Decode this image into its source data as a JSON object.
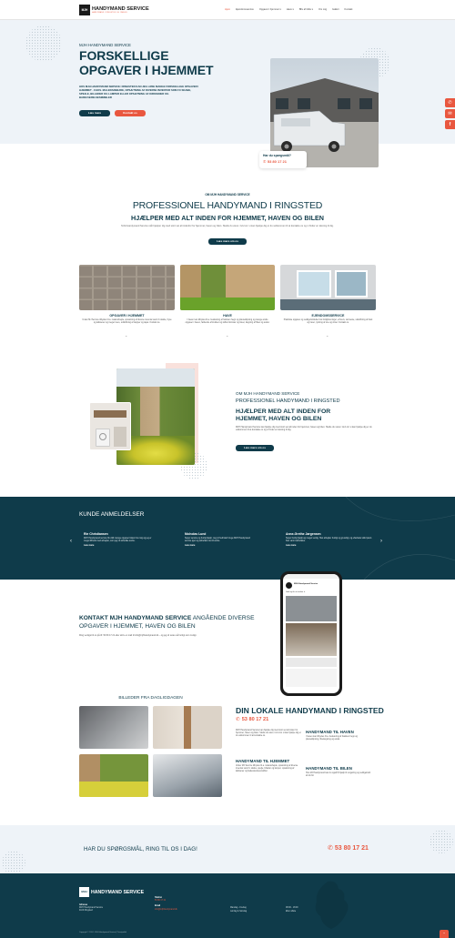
{
  "header": {
    "logo_mark": "MJH",
    "logo_text": "HANDYMAND SERVICE",
    "logo_sub": "HANDYMAND I RINGSTED OG OMEGN",
    "nav": [
      "Hjem",
      "Ejendomsservice",
      "Opgaver i hjemmet ▾",
      "Have ▾",
      "Bliv af folks ▾",
      "Om mig",
      "Galleri",
      "Kontakt"
    ]
  },
  "hero": {
    "kicker": "MJH HANDYMAND SERVICE",
    "title_line1": "FORSKELLIGE",
    "title_line2": "OPGAVER I HJEMMET",
    "text": "HOS MJH HANDYMAND SERVICE I RINGSTED KAN JEG LØSE MANGE FORSKELLIGE OPGAVER I HJEMMET - F.EKS. MALERARBEJDE, OPSÆTNING AF DIVERSE INVENTAR SOM FX SKABE, SPEJLE, BILLEDER OG LAMPER ELLER OPSÆTNING AF KØKKENER OG BADEVÆRELSESMØBLER",
    "btn_primary": "Læs mere",
    "btn_secondary": "Kontakt os",
    "question": "Har du spørgsmål?",
    "phone": "53 80 17 21"
  },
  "side_buttons": [
    "phone-icon",
    "mail-icon",
    "facebook-icon"
  ],
  "intro": {
    "kicker": "OM MJH HANDYMAND SERVICE",
    "title": "PROFESSIONEL HANDYMAND I RINGSTED",
    "subtitle": "HJÆLPER MED ALT INDEN FOR HJEMMET, HAVEN OG BILEN",
    "text": "MJH Handymand Service står hjælper dig med stort set alt indenfor for hjemmet, haven og bilen. Skulle du være i tvivl om vi kan hjælpe dig er du velkommen til at kontakte os og vi finder en løsning til dig.",
    "button": "Læs mere om os"
  },
  "services": [
    {
      "title": "OPGAVER I HJEMMET",
      "text": "Under MJ Service tilbydes bl.a. malerarbejde, opsætning af diverse inventar samt fx skabe, fryse og køkkener og meget mere, udskiftning af tæpper og tapet. Kontakt os.",
      "arrow": "⌄"
    },
    {
      "title": "HAVE",
      "text": "I haven kan tilbydes bl.a. beskæring af hækken hegn og plæneklipning og mange andre opgaver i haven, faldende af krukker og skifte blomster og træer, lægning af fliser og andet.",
      "arrow": "⌄"
    },
    {
      "title": "EJENDOMSSERVICE",
      "text": "Praktiske opgaver og vedligeholdelse hos boligforeninger, erhverv, varmeste, udskiftning af hæk og træer, rydning af sne og vinter. Kontakt os.",
      "arrow": "⌄"
    }
  ],
  "about": {
    "kicker": "OM MJH HANDYMAND SERVICE",
    "title": "PROFESSIONEL HANDYMAND I RINGSTED",
    "subtitle": "HJÆLPER MED ALT INDEN FOR HJEMMET, HAVEN OG BILEN",
    "text": "MJH Handymand Service kan hjælpe dig med stort set alt inden for hjemmet, haven og bilen. Skulle du være i tvivl om vi kan hjælpe dig er du velkommen til at kontakte os og vi finder en løsning til dig.",
    "button": "Læs mere om os"
  },
  "reviews": {
    "title": "KUNDE ANMELDELSER",
    "items": [
      {
        "name": "Rie Christiansen",
        "text": "MJH Handymand service fik vildt mange opgaver klaret hos mig og jeg er meget tilfreds med arbejdet, som jeg vil anbefale andre.",
        "more": "Læs mere"
      },
      {
        "name": "Nicholas Lund",
        "text": "Super service og hurtig hjælp. Jeg vil helt klart bruge MJH Handymand service igen og anbefaler det til andre.",
        "more": "Læs mere"
      },
      {
        "name": "Anne-Grethe Jørgensen",
        "text": "Super hurtig hjælp og meget venlig. Han arbejder hurtigt og grundigt, og efterlader altid pænt. Kan varmt anbefales.",
        "more": "Læs mere"
      }
    ],
    "prev": "‹",
    "next": "›"
  },
  "contact": {
    "title_bold": "KONTAKT MJH HANDYMAND SERVICE",
    "title_rest": "ANGÅENDE DIVERSE OPGAVER I HJEMMET, HAVEN OG BILEN",
    "text": "Ring venligst til os på tlf. 53 80 17 21 eller skriv en mail til info@mjhhandymand.dk – og jeg vil svare så hurtigt som muligt.",
    "phone_app_name": "MJH Handymand Service",
    "phone_post": "Godt nyt fra at vinden ☀"
  },
  "gallery": {
    "title": "BILLEDER FRA DAGLIGDAGEN"
  },
  "local": {
    "title": "DIN LOKALE HANDYMAND I RINGSTED",
    "phone": "53 80 17 21",
    "intro": "MJH Handymand Service kan hjælpe dig med stort set alt inden for hjemmet, haven og bilen. Skulle du være i tvivl om vi kan hjælpe dig er du velkommen til at kontakte os.",
    "blocks": [
      {
        "title": "HANDYMAND TIL HJEMMET",
        "text": "Under MJ Service tilbydes bl.a. malerarbejde, opsætning af diverse inventar samt fx skabe, spejle, billeder og lamper, opsætning af køkkener og badeværelsesmøbler."
      },
      {
        "title": "HANDYMAND TIL HAVEN",
        "text": "I haven kan tilbydes bl.a. beskæring af hækken hegn og plæneklipning, fliselægning og andet."
      },
      {
        "title": "HANDYMAND TIL BILEN",
        "text": "Hos MJ Handymand kan du også få hjælp til rengøring og vedligehold af din bil."
      }
    ]
  },
  "cta": {
    "text": "HAR DU SPØRGSMÅL, RING TIL OS I DAG!",
    "phone": "53 80 17 21"
  },
  "footer": {
    "logo_mark": "MJH",
    "logo_text": "HANDYMAND SERVICE",
    "address_label": "Adresse",
    "address_lines": [
      "MJH Handymand Service",
      "4100 Ringsted"
    ],
    "phone_label": "Telefon",
    "phone": "53 80 17 21",
    "email_label": "Email",
    "email": "info@mjhhandymand.dk",
    "hours": [
      "Mandag - Fredag",
      "Lørdag & Søndag"
    ],
    "hours_values": [
      "08:00 - 18:00",
      "Efter aftale"
    ],
    "copyright": "Copyright © 2024 - MJH Handymand Service | Privatpolitik"
  },
  "colors": {
    "navy": "#0f3b4a",
    "orange": "#e9573f",
    "light": "#eef3f8"
  }
}
